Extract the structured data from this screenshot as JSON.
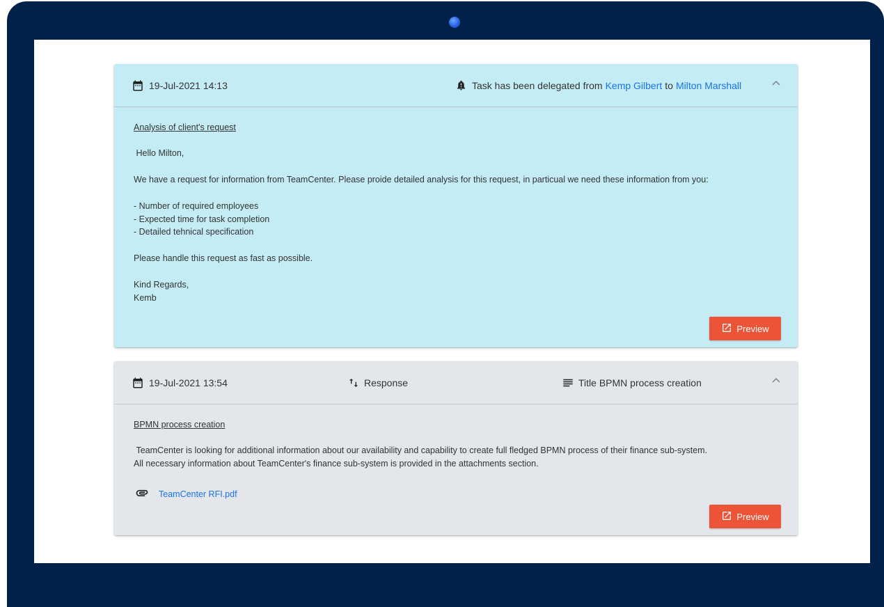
{
  "cards": [
    {
      "date": "19-Jul-2021 14:13",
      "delegation": {
        "prefix": "Task has been delegated from",
        "from": "Kemp Gilbert",
        "connector": "to",
        "to": "Milton Marshall"
      },
      "subject": "Analysis of client's request",
      "greeting": " Hello Milton,",
      "intro": "We have a request for information from TeamCenter. Please proide detailed analysis for this request, in particual we need these information from you:",
      "list": [
        "- Number of required employees",
        "- Expected time for task completion",
        "- Detailed tehnical specification"
      ],
      "closing": "Please handle this request as fast as possible.",
      "regards": "Kind Regards,",
      "signature": "Kemb",
      "preview_label": "Preview"
    },
    {
      "date": "19-Jul-2021 13:54",
      "type_label": "Response",
      "title_label": "Title BPMN process creation",
      "subject": "BPMN process creation",
      "line1": " TeamCenter is looking for additional information about our availability and capability to create full fledged BPMN process of their finance sub-system.",
      "line2": "All necessary information about TeamCenter's finance sub-system is provided in the attachments section.",
      "attachment": "TeamCenter RFI.pdf",
      "preview_label": "Preview"
    }
  ],
  "colors": {
    "card_active": "#c4ecf4",
    "card_default": "#e3e7eb",
    "link": "#1a73e8",
    "button": "#ec5337",
    "frame": "#00224a"
  }
}
